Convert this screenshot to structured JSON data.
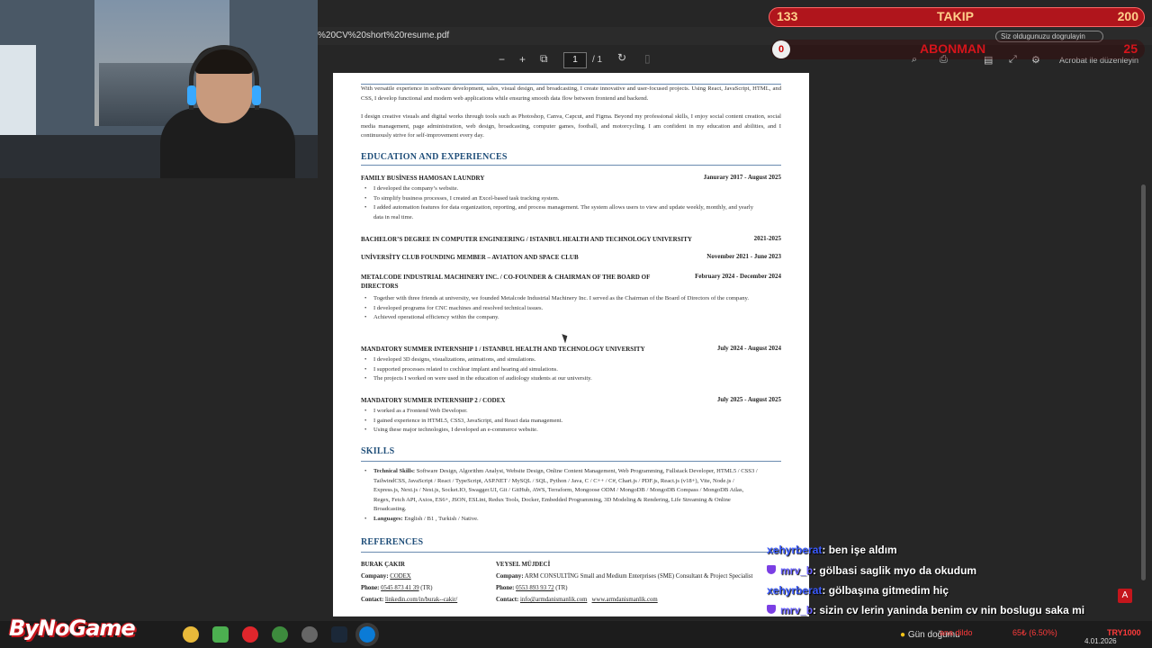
{
  "browser": {
    "url": "%20CV%20short%20resume.pdf",
    "feedback": "Siz oldugunuzu dogrulayin"
  },
  "pdf_toolbar": {
    "zoom_out": "−",
    "zoom_in": "+",
    "page_current": "1",
    "page_total": "/ 1",
    "acrobat_label": "Acrobat ile düzenleyin"
  },
  "resume": {
    "intro1": "With versatile experience in software development, sales, visual design, and broadcasting, I create innovative and user-focused projects. Using React, JavaScript, HTML, and CSS, I develop functional and modern web applications while ensuring smooth data flow between frontend and backend.",
    "intro2": "I design creative visuals and digital works through tools such as Photoshop, Canva, Capcut, and Figma. Beyond my professional skills, I enjoy social content creation, social media management, page administration, web design, broadcasting, computer games, football, and motorcycling. I am confident in my education and abilities, and I continuously strive for self-improvement every day.",
    "edu_heading": "EDUCATION AND EXPERIENCES",
    "entries": [
      {
        "title": "FAMILY BUSİNESS HAMOSAN LAUNDRY",
        "date": "Janurary 2017 - August 2025",
        "bullets": [
          "I developed the company’s website.",
          "To simplify business processes, I created an Excel-based task tracking system.",
          "I added automation features for data organization, reporting, and process management. The system allows users to view and update weekly, monthly, and yearly data in real time."
        ]
      },
      {
        "title": "BACHELOR’S DEGREE IN COMPUTER ENGINEERING / ISTANBUL HEALTH AND TECHNOLOGY UNIVERSITY",
        "date": "2021-2025"
      },
      {
        "title": "UNİVERSİTY CLUB FOUNDING MEMBER – AVIATION AND SPACE CLUB",
        "date": "November 2021 - June 2023"
      },
      {
        "title": "METALCODE INDUSTRIAL MACHINERY INC. / CO-FOUNDER & CHAIRMAN OF THE BOARD OF DIRECTORS",
        "date": "February 2024 - December 2024",
        "bullets": [
          "Together with three friends at university, we founded Metalcode Industrial Machinery Inc. I served as the Chairman of the Board of Directors of the company.",
          "I developed programs for CNC machines and resolved technical issues.",
          "Achieved operational efficiency within the company."
        ]
      },
      {
        "title": "MANDATORY SUMMER INTERNSHIP 1 / ISTANBUL HEALTH AND TECHNOLOGY UNIVERSITY",
        "date": "July 2024 - August 2024",
        "bullets": [
          "I developed 3D designs, visualizations, animations, and simulations.",
          "I supported processes related to cochlear implant and hearing aid simulations.",
          "The projects I worked on were used in the education of audiology students at our university."
        ]
      },
      {
        "title": "MANDATORY SUMMER INTERNSHIP 2 / CODEX",
        "date": "July 2025 - August 2025",
        "bullets": [
          "I worked as a Frontend Web Developer.",
          "I gained experience in HTML5, CSS3, JavaScript, and React data management.",
          "Using these major technologies, I developed an e-commerce website."
        ]
      }
    ],
    "skills_heading": "SKILLS",
    "tech_label": "Technical Skills:",
    "tech_value": "Software Design, Algorithm Analyst, Website Design, Online Content Management, Web Programming, Fullstack Developer, HTML5 / CSS3 / TailwindCSS, JavaScript / React / TypeScript, ASP.NET / MySQL / SQL, Python / Java, C / C++ / C#, Chart.js / PDF.js, React.js (v18+), Vite, Node.js / Express.js, Next.js / Nest.js, Socket.IO, Swagger.UI, Git / GitHub, AWS, Terraform, Mongoose ODM / MongoDB / MongoDB Compass / MongoDB Atlas, Regex, Fetch API, Axios, ES6+, JSON, ESLint, Redux Tools, Docker, Embedded Programming, 3D Modeling & Rendering, Life Streaming & Online Broadcasting.",
    "lang_label": "Languages:",
    "lang_value": "English / B1 , Turkish / Native.",
    "ref_heading": "REFERENCES",
    "ref1": {
      "name": "BURAK ÇAKIR",
      "company_label": "Company:",
      "company": "CODEX",
      "phone_label": "Phone:",
      "phone": "0545 873 41 39",
      "phone_suffix": "(TR)",
      "contact_label": "Contact:",
      "contact": "linkedin.com/in/burak--cakir/"
    },
    "ref2": {
      "name": "VEYSEL MÜJDECİ",
      "company_label": "Company:",
      "company": "ARM CONSULTİNG Small and Medium Enterprises (SME) Consultant & Project Specialist",
      "phone_label": "Phone:",
      "phone": "0553 893 93 72",
      "phone_suffix": "(TR)",
      "contact_label": "Contact:",
      "contact": "info@armdanismanlik.com",
      "contact2": "www.armdanismanlik.com"
    }
  },
  "stream": {
    "follow_current": "133",
    "follow_label": "TAKIP",
    "follow_goal": "200",
    "sub_current": "0",
    "sub_label": "ABONMAN",
    "sub_goal": "25",
    "logo": "ByNoGame"
  },
  "chat": [
    {
      "user": "xehyrberat",
      "msg": ": ben işe aldım"
    },
    {
      "user": "mrv_b",
      "msg": ": gölbasi saglik myo da okudum"
    },
    {
      "user": "xehyrberat",
      "msg": ": gölbaşına gitmedim hiç"
    },
    {
      "user": "mrv_b",
      "msg": ": sizin cv lerin yaninda benim cv nin boslugu saka mi"
    }
  ],
  "taskbar": {
    "weather": "Gün doğumu",
    "ticker": "ana dildo",
    "ticker_amount": "65₺ (6.50%)",
    "ticker_total": "TRY1000",
    "date": "4.01.2026"
  },
  "colors": {
    "accent": "#1f4e79",
    "overlay_red": "#b0151c"
  }
}
